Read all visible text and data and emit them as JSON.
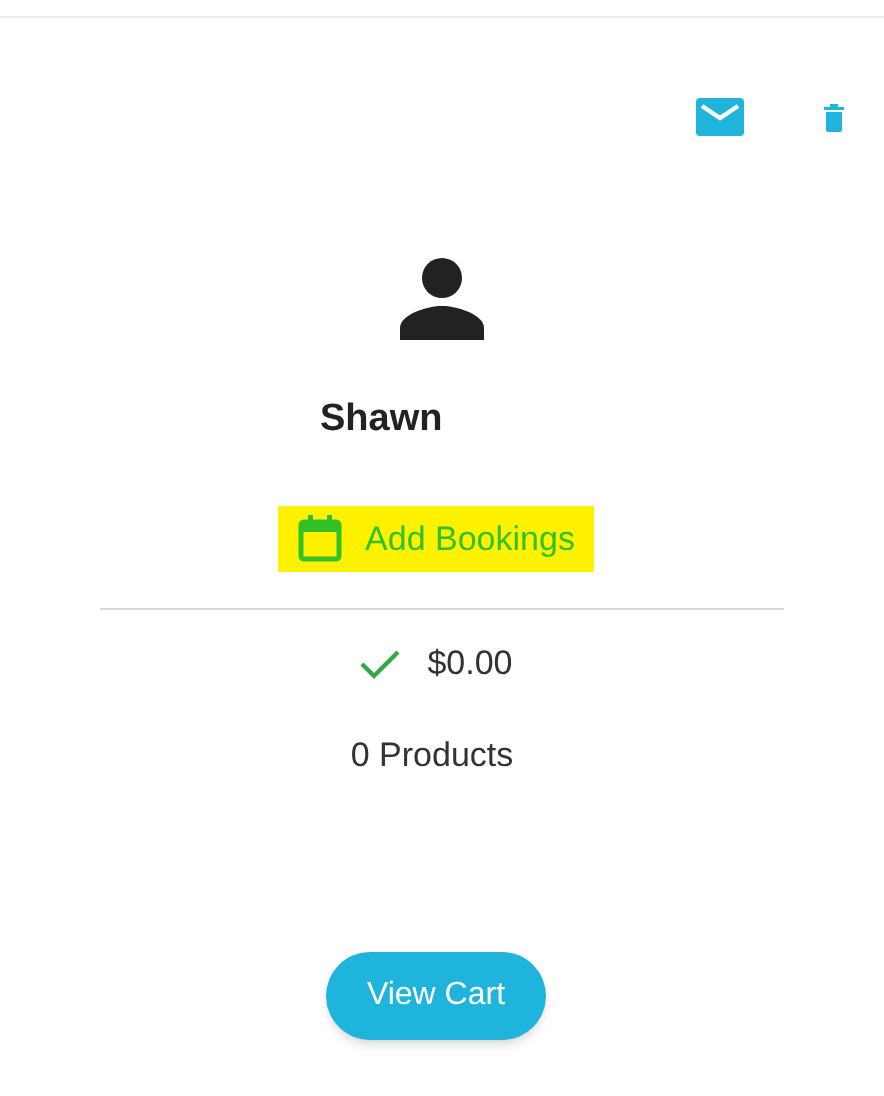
{
  "customer": {
    "name": "Shawn"
  },
  "booking_link": {
    "label": "Add Bookings",
    "highlighted": true
  },
  "cart": {
    "paid": true,
    "total": "$0.00",
    "products": "0 Products"
  },
  "buttons": [
    {
      "label": "View Cart"
    }
  ]
}
